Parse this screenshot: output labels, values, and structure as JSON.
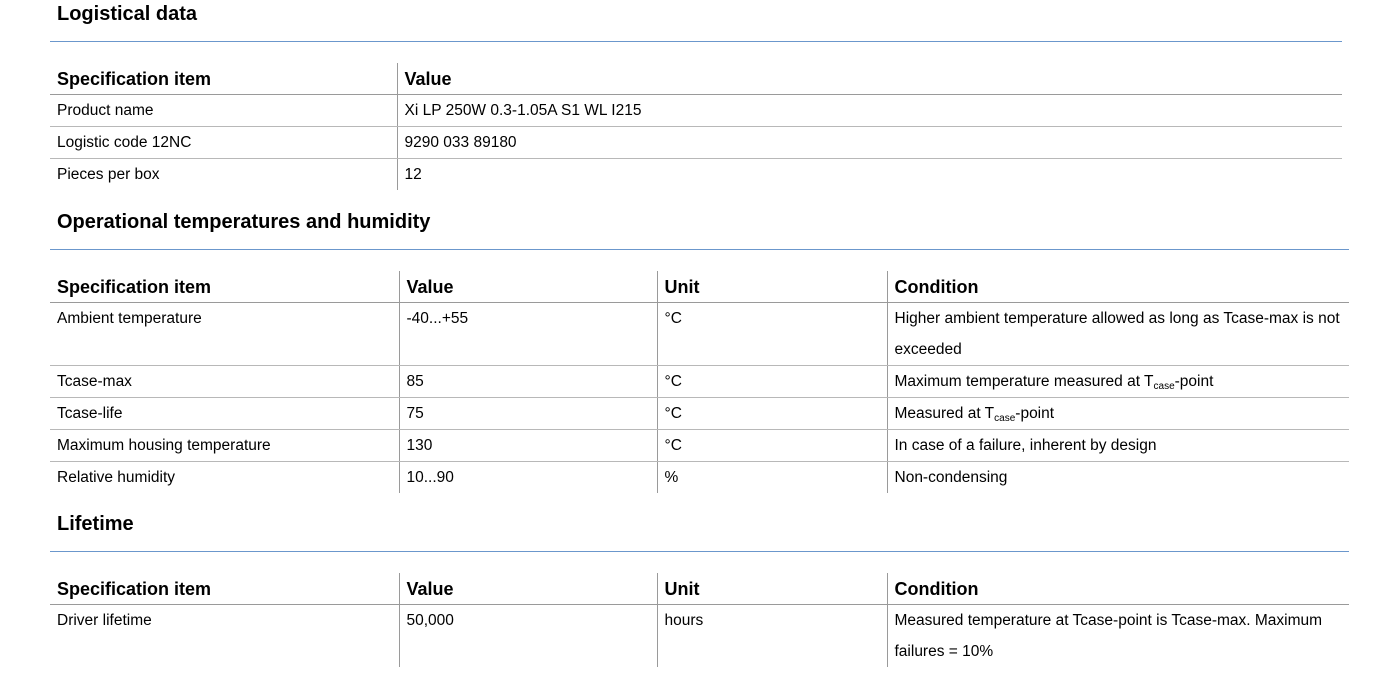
{
  "sections": {
    "logistical": {
      "title": "Logistical data",
      "headers": [
        "Specification item",
        "Value"
      ],
      "rows": [
        [
          "Product name",
          "Xi LP 250W 0.3-1.05A S1 WL I215"
        ],
        [
          "Logistic code 12NC",
          "9290 033 89180"
        ],
        [
          "Pieces per box",
          "12"
        ]
      ]
    },
    "operational": {
      "title": "Operational temperatures and humidity",
      "headers": [
        "Specification item",
        "Value",
        "Unit",
        "Condition"
      ],
      "rows": [
        [
          "Ambient temperature",
          "-40...+55",
          "°C",
          "Higher ambient temperature allowed as long as Tcase-max is not exceeded"
        ],
        [
          "Tcase-max",
          "85",
          "°C",
          {
            "pre": "Maximum temperature measured at T",
            "sub": "case",
            "post": "-point"
          }
        ],
        [
          "Tcase-life",
          "75",
          "°C",
          {
            "pre": "Measured at T",
            "sub": "case",
            "post": "-point"
          }
        ],
        [
          "Maximum housing temperature",
          "130",
          "°C",
          "In case of a failure, inherent by design"
        ],
        [
          "Relative humidity",
          "10...90",
          "%",
          "Non-condensing"
        ]
      ]
    },
    "lifetime": {
      "title": "Lifetime",
      "headers": [
        "Specification item",
        "Value",
        "Unit",
        "Condition"
      ],
      "rows": [
        [
          "Driver lifetime",
          "50,000",
          "hours",
          "Measured temperature at Tcase-point is Tcase-max. Maximum failures = 10%"
        ]
      ]
    }
  }
}
